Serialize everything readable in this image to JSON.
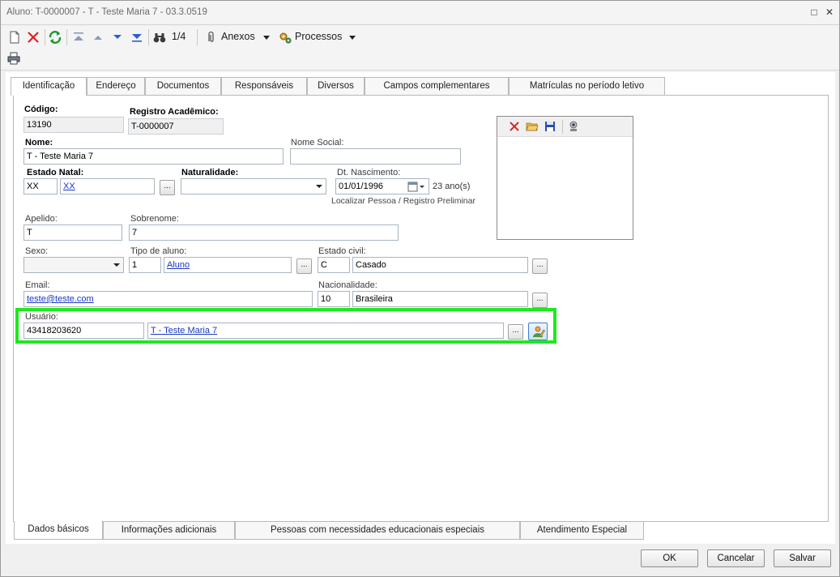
{
  "window": {
    "title": "Aluno: T-0000007 - T - Teste Maria 7 - 03.3.0519"
  },
  "toolbar": {
    "nav_counter": "1/4",
    "anexos_label": "Anexos",
    "processos_label": "Processos"
  },
  "tabs_top": [
    {
      "label": "Identificação"
    },
    {
      "label": "Endereço"
    },
    {
      "label": "Documentos"
    },
    {
      "label": "Responsáveis"
    },
    {
      "label": "Diversos"
    },
    {
      "label": "Campos complementares"
    },
    {
      "label": "Matrículas no período letivo"
    }
  ],
  "tabs_bottom": [
    {
      "label": "Dados básicos"
    },
    {
      "label": "Informações adicionais"
    },
    {
      "label": "Pessoas com necessidades educacionais especiais"
    },
    {
      "label": "Atendimento Especial"
    }
  ],
  "form": {
    "codigo": {
      "label": "Código:",
      "value": "13190"
    },
    "registro": {
      "label": "Registro Acadêmico:",
      "value": "T-0000007"
    },
    "nome": {
      "label": "Nome:",
      "value": "T - Teste Maria 7"
    },
    "nome_social": {
      "label": "Nome Social:",
      "value": ""
    },
    "estado_natal": {
      "label": "Estado Natal:",
      "code": "XX",
      "name": "XX"
    },
    "naturalidade": {
      "label": "Naturalidade:",
      "value": ""
    },
    "dt_nascimento": {
      "label": "Dt. Nascimento:",
      "value": "01/01/1996",
      "age": "23 ano(s)"
    },
    "localizar_link": "Localizar Pessoa / Registro Preliminar",
    "apelido": {
      "label": "Apelido:",
      "value": "T"
    },
    "sobrenome": {
      "label": "Sobrenome:",
      "value": "7"
    },
    "sexo": {
      "label": "Sexo:",
      "value": ""
    },
    "tipo_aluno": {
      "label": "Tipo de aluno:",
      "code": "1",
      "name": "Aluno"
    },
    "estado_civil": {
      "label": "Estado civil:",
      "code": "C",
      "name": "Casado"
    },
    "email": {
      "label": "Email:",
      "value": "teste@teste.com"
    },
    "nacionalidade": {
      "label": "Nacionalidade:",
      "code": "10",
      "name": "Brasileira"
    },
    "usuario": {
      "label": "Usuário:",
      "code": "43418203620",
      "name": "T - Teste Maria 7"
    }
  },
  "buttons": {
    "ok": "OK",
    "cancelar": "Cancelar",
    "salvar": "Salvar"
  },
  "colors": {
    "highlight": "#1ee81e",
    "link": "#1a37c4",
    "delete_red": "#e02020"
  }
}
